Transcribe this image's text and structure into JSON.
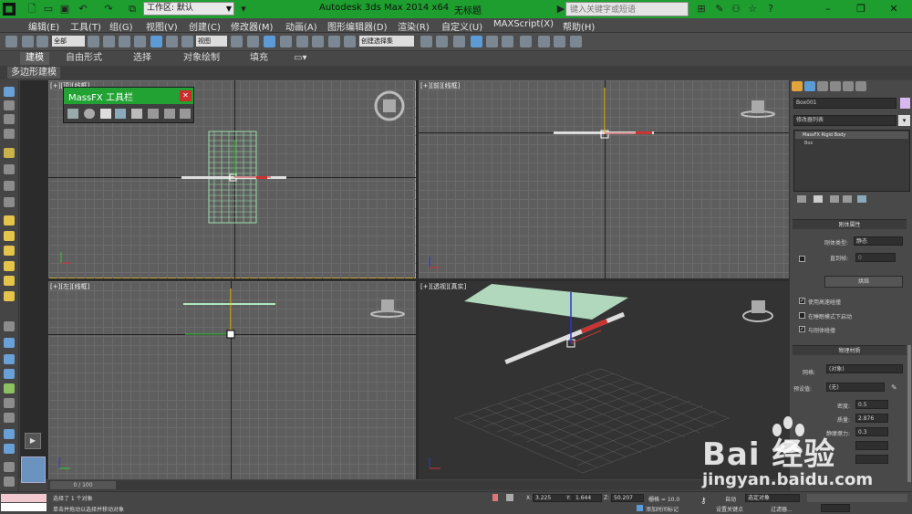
{
  "titlebar": {
    "workspace_value": "工作区: 默认",
    "app_title": "Autodesk 3ds Max  2014 x64",
    "doc_title": "无标题",
    "search_placeholder": "键入关键字或短语"
  },
  "menu": [
    "编辑(E)",
    "工具(T)",
    "组(G)",
    "视图(V)",
    "创建(C)",
    "修改器(M)",
    "动画(A)",
    "图形编辑器(D)",
    "渲染(R)",
    "自定义(U)",
    "MAXScript(X)",
    "帮助(H)"
  ],
  "toolbar": {
    "selection_filter": "全部",
    "ref_coord": "视图",
    "named_selection": "创建选择集"
  },
  "ribbon": {
    "tabs": [
      "建模",
      "自由形式",
      "选择",
      "对象绘制",
      "填充"
    ],
    "active_tab": "建模",
    "sub_label": "多边形建模"
  },
  "viewports": {
    "top_left_label": "[+][顶][线框]",
    "top_right_label": "[+][前][线框]",
    "bottom_left_label": "[+][左][线框]",
    "bottom_right_label": "[+][透视][真实]"
  },
  "massfx": {
    "title": "MassFX 工具栏"
  },
  "cmdpanel": {
    "object_name": "Box001",
    "modifier_list": "修改器列表",
    "stack": [
      "MassFX Rigid Body",
      "Box"
    ],
    "rigid_rollout": "刚体属性",
    "rigid_type_label": "刚体类型:",
    "rigid_type_value": "静态",
    "until_frame_label": "直到帧:",
    "until_frame_value": "0",
    "bake_button": "烘焙",
    "cb_high_speed": "使用高速碰撞",
    "cb_sleep": "在睡眠模式下启动",
    "cb_collide": "与刚体碰撞",
    "physmat_rollout": "物理材质",
    "mesh_label": "网格:",
    "mesh_value": "(对象)",
    "preset_label": "预设值:",
    "preset_value": "(无)",
    "density_label": "密度:",
    "density_value": "0.5",
    "mass_label": "质量:",
    "mass_value": "2.876",
    "static_friction_label": "静摩擦力:",
    "static_friction_value": "0.3"
  },
  "status": {
    "frame": "0 / 100",
    "selected": "选择了 1 个对象",
    "prompt": "单击并拖动以选择并移动对象",
    "x_label": "X:",
    "x_value": "3.225",
    "y_label": "Y:",
    "y_value": "1.644",
    "z_label": "Z:",
    "z_value": "50.207",
    "grid": "栅格 = 10.0",
    "add_time_tag": "添加时间标记",
    "auto_key": "自动",
    "set_key": "设置关键点",
    "key_filter_value": "选定对象",
    "key_filters": "过滤器..."
  },
  "watermark": {
    "brand": "Bai 经验",
    "url": "jingyan.baidu.com"
  },
  "colors": {
    "title_green": "#1d9e2e",
    "viewport_grid": "#5e5e5e",
    "active_border": "#c2a53c",
    "close_red": "#c9302c",
    "plane_green": "#b8e2c4"
  }
}
